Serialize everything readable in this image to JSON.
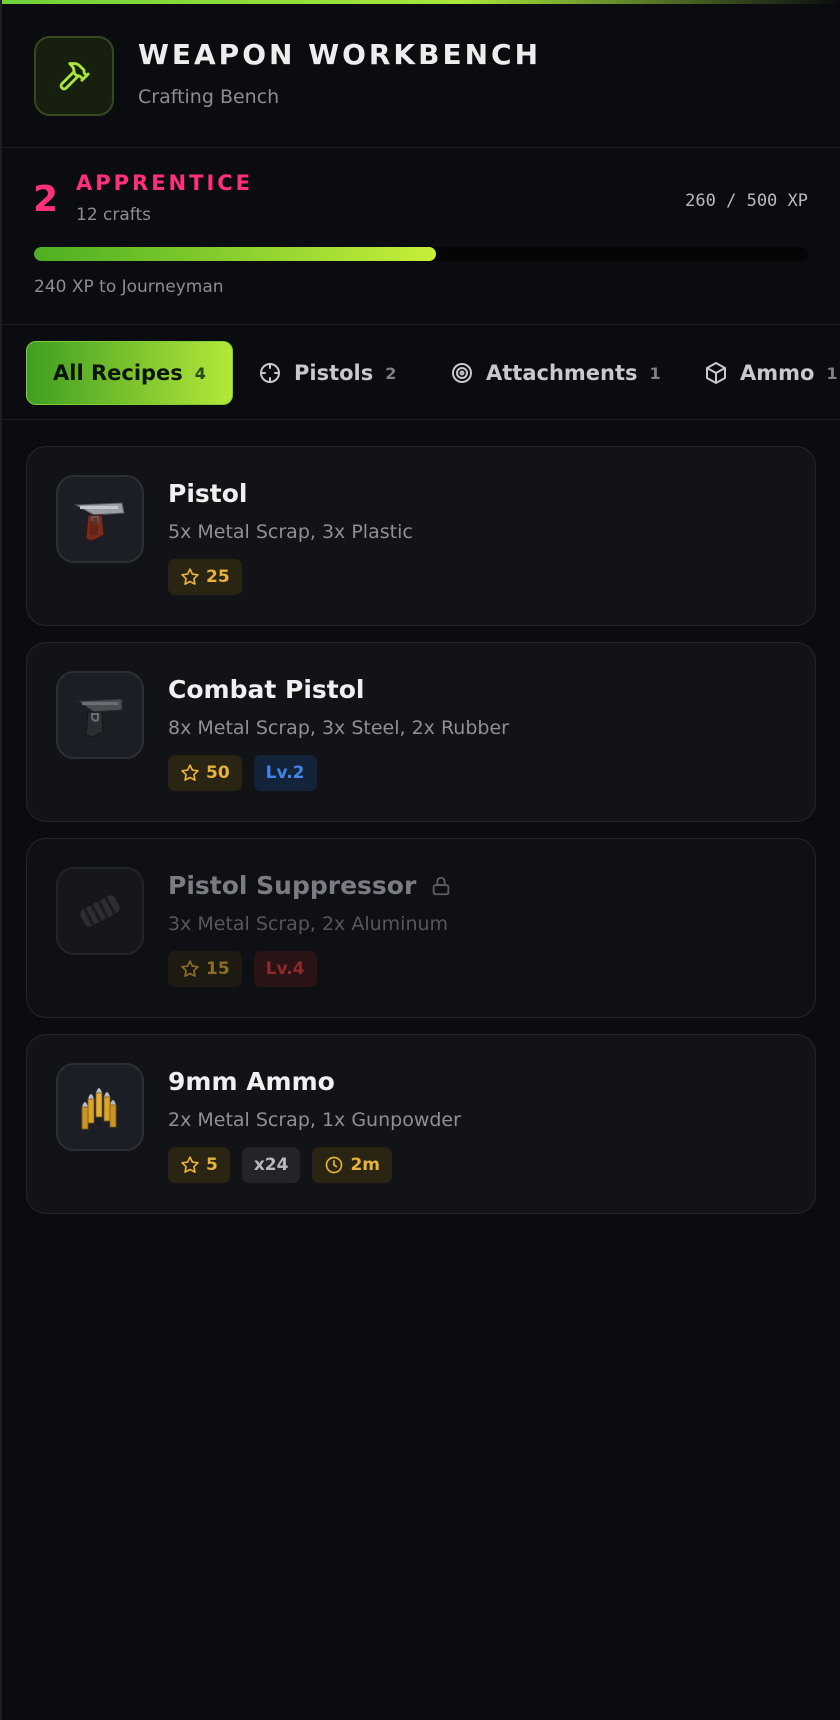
{
  "colors": {
    "accent_green": "#a8e83a",
    "level_pink": "#ff2f7d",
    "star_gold": "#e9b23a",
    "level_blue": "#3f86e6",
    "lock_red": "#8e2a2c"
  },
  "header": {
    "icon": "hammer-icon",
    "title": "WEAPON WORKBENCH",
    "subtitle": "Crafting Bench"
  },
  "level": {
    "number": "2",
    "name": "APPRENTICE",
    "crafts": "12 crafts",
    "xp_text": "260 / 500 XP",
    "xp_progress": 0.52,
    "next_text": "240 XP to Journeyman"
  },
  "tabs": [
    {
      "label": "All Recipes",
      "count": "4",
      "icon": "",
      "active": true
    },
    {
      "label": "Pistols",
      "count": "2",
      "icon": "crosshair-icon",
      "active": false
    },
    {
      "label": "Attachments",
      "count": "1",
      "icon": "target-icon",
      "active": false
    },
    {
      "label": "Ammo",
      "count": "1",
      "icon": "box-icon",
      "active": false
    }
  ],
  "recipes": [
    {
      "name": "Pistol",
      "ingredients": "5x Metal Scrap, 3x Plastic",
      "icon": "pistol-icon",
      "xp": "25",
      "locked": false
    },
    {
      "name": "Combat Pistol",
      "ingredients": "8x Metal Scrap, 3x Steel, 2x Rubber",
      "icon": "combat-pistol-icon",
      "xp": "50",
      "level": "Lv.2",
      "locked": false
    },
    {
      "name": "Pistol Suppressor",
      "ingredients": "3x Metal Scrap, 2x Aluminum",
      "icon": "suppressor-icon",
      "xp": "15",
      "level": "Lv.4",
      "locked": true
    },
    {
      "name": "9mm Ammo",
      "ingredients": "2x Metal Scrap, 1x Gunpowder",
      "icon": "ammo-icon",
      "xp": "5",
      "quantity": "x24",
      "time": "2m",
      "locked": false
    }
  ]
}
